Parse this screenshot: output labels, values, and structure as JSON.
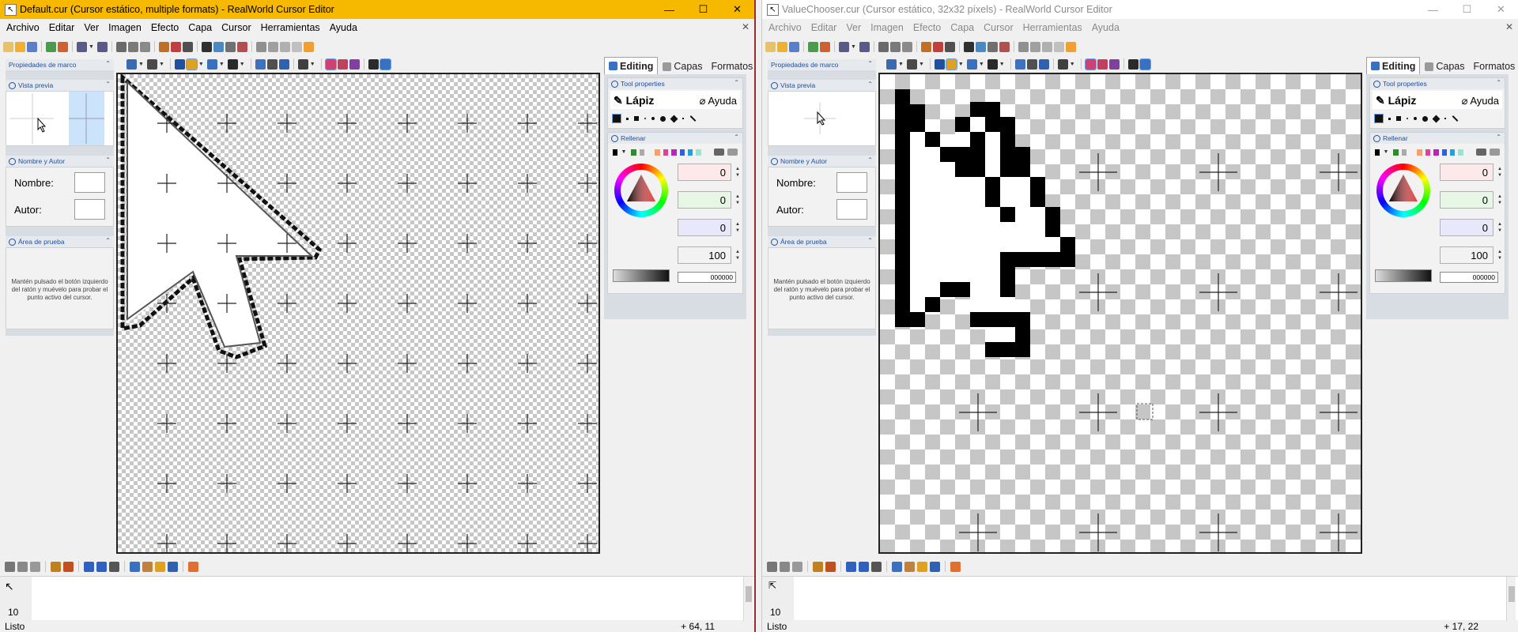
{
  "left": {
    "title": "Default.cur (Cursor estático, multiple formats) - RealWorld Cursor Editor",
    "menu": [
      "Archivo",
      "Editar",
      "Ver",
      "Imagen",
      "Efecto",
      "Capa",
      "Cursor",
      "Herramientas",
      "Ayuda"
    ],
    "panels": {
      "frame_props": "Propiedades de marco",
      "preview": "Vista previa",
      "name_author": "Nombre y Autor",
      "name_label": "Nombre:",
      "author_label": "Autor:",
      "test_area": "Área de prueba",
      "test_text": "Mantén pulsado el botón izquierdo del ratón y muévelo para probar el punto activo del cursor."
    },
    "tabs": [
      "Editing",
      "Capas",
      "Formatos"
    ],
    "tool_properties": "Tool properties",
    "tool_name": "Lápiz",
    "help": "Ayuda",
    "fill": "Rellenar",
    "rgba": [
      "0",
      "0",
      "0",
      "100"
    ],
    "hex": "000000",
    "frame_number": "10",
    "status": "Listo",
    "coords": "+ 64, 11"
  },
  "right": {
    "title": "ValueChooser.cur (Cursor estático, 32x32 píxels) - RealWorld Cursor Editor",
    "menu": [
      "Archivo",
      "Editar",
      "Ver",
      "Imagen",
      "Efecto",
      "Capa",
      "Cursor",
      "Herramientas",
      "Ayuda"
    ],
    "panels": {
      "frame_props": "Propiedades de marco",
      "preview": "Vista previa",
      "name_author": "Nombre y Autor",
      "name_label": "Nombre:",
      "author_label": "Autor:",
      "test_area": "Área de prueba",
      "test_text": "Mantén pulsado el botón izquierdo del ratón y muévelo para probar el punto activo del cursor."
    },
    "tabs": [
      "Editing",
      "Capas",
      "Formatos"
    ],
    "tool_properties": "Tool properties",
    "tool_name": "Lápiz",
    "help": "Ayuda",
    "fill": "Rellenar",
    "rgba": [
      "0",
      "0",
      "0",
      "100"
    ],
    "hex": "000000",
    "frame_number": "10",
    "status": "Listo",
    "coords": "+ 17, 22"
  },
  "window_controls": {
    "minimize": "—",
    "maximize": "☐",
    "close": "✕"
  },
  "colors": {
    "title_active": "#f6b900",
    "title_inactive": "#ffffff",
    "accent": "#1f4f9a"
  }
}
